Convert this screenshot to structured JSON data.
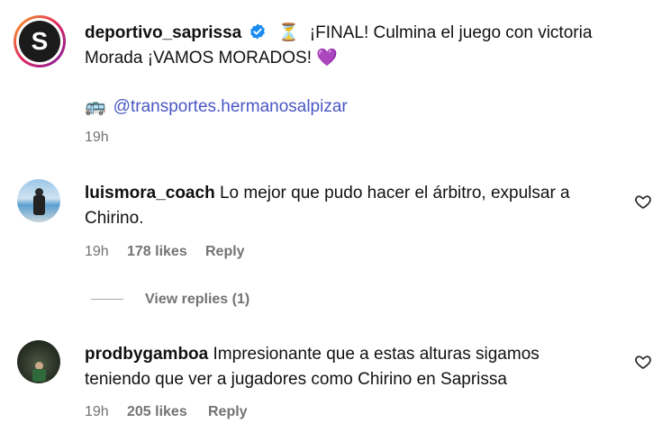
{
  "caption": {
    "username": "deportivo_saprissa",
    "hourglass": "⏳",
    "text_line1": "¡FINAL! Culmina el juego con victoria",
    "text_line2": "Morada ¡VAMOS MORADOS! ",
    "heart": "💜",
    "bus": "🚌",
    "mention": "@transportes.hermanosalpizar",
    "time": "19h",
    "avatar_letter": "S"
  },
  "comments": [
    {
      "username": "luismora_coach",
      "text_line1": "Lo mejor que pudo hacer el árbitro, expulsar a",
      "text_line2": "Chirino.",
      "time": "19h",
      "likes": "178 likes",
      "reply": "Reply",
      "view_replies": "View replies (1)"
    },
    {
      "username": "prodbygamboa",
      "text_line1": "Impresionante que a estas alturas sigamos",
      "text_line2": "teniendo que ver a jugadores como Chirino en Saprissa",
      "time": "19h",
      "likes": "205 likes",
      "reply": "Reply"
    }
  ],
  "colors": {
    "verified": "#1a8cf0",
    "mention": "#4a57c4",
    "meta": "#737373",
    "avatar_ring": "#e0245e"
  },
  "icons": [
    "verified-badge-icon",
    "heart-outline-icon"
  ]
}
